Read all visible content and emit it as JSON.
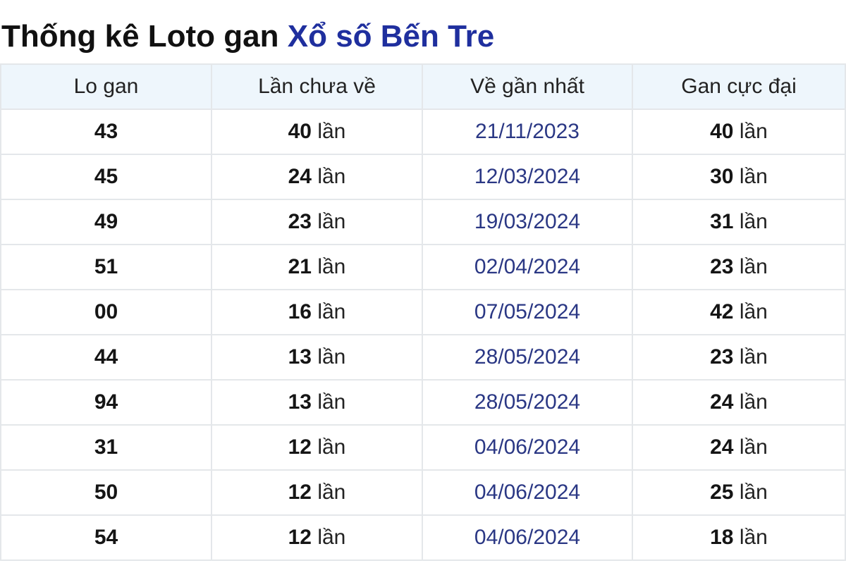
{
  "title": {
    "prefix": "Thống kê Loto gan",
    "brand": "Xổ số Bến Tre"
  },
  "table": {
    "headers": [
      "Lo gan",
      "Lần chưa về",
      "Về gần nhất",
      "Gan cực đại"
    ],
    "unit": "lần",
    "rows": [
      {
        "lo": "43",
        "chua_ve": "40",
        "ve_gan_nhat": "21/11/2023",
        "gan_cuc_dai": "40"
      },
      {
        "lo": "45",
        "chua_ve": "24",
        "ve_gan_nhat": "12/03/2024",
        "gan_cuc_dai": "30"
      },
      {
        "lo": "49",
        "chua_ve": "23",
        "ve_gan_nhat": "19/03/2024",
        "gan_cuc_dai": "31"
      },
      {
        "lo": "51",
        "chua_ve": "21",
        "ve_gan_nhat": "02/04/2024",
        "gan_cuc_dai": "23"
      },
      {
        "lo": "00",
        "chua_ve": "16",
        "ve_gan_nhat": "07/05/2024",
        "gan_cuc_dai": "42"
      },
      {
        "lo": "44",
        "chua_ve": "13",
        "ve_gan_nhat": "28/05/2024",
        "gan_cuc_dai": "23"
      },
      {
        "lo": "94",
        "chua_ve": "13",
        "ve_gan_nhat": "28/05/2024",
        "gan_cuc_dai": "24"
      },
      {
        "lo": "31",
        "chua_ve": "12",
        "ve_gan_nhat": "04/06/2024",
        "gan_cuc_dai": "24"
      },
      {
        "lo": "50",
        "chua_ve": "12",
        "ve_gan_nhat": "04/06/2024",
        "gan_cuc_dai": "25"
      },
      {
        "lo": "54",
        "chua_ve": "12",
        "ve_gan_nhat": "04/06/2024",
        "gan_cuc_dai": "18"
      }
    ]
  },
  "colors": {
    "brand": "#1f2f9e",
    "header_bg": "#eef6fc",
    "border": "#e4e7ea",
    "date_text": "#2a3784"
  }
}
